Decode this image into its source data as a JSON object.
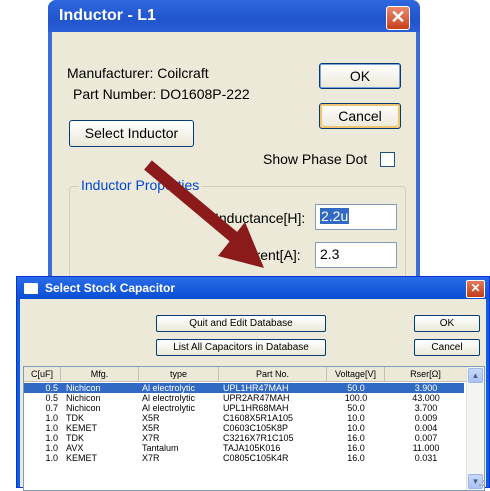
{
  "inductor_dialog": {
    "title": "Inductor - L1",
    "close_glyph": "✕",
    "manufacturer_label": "Manufacturer: Coilcraft",
    "part_number_label": "Part Number: DO1608P-222",
    "ok_label": "OK",
    "cancel_label": "Cancel",
    "select_inductor_label": "Select Inductor",
    "show_phase_dot_label": "Show Phase Dot",
    "show_phase_dot_checked": false,
    "group_title": "Inductor Properties",
    "inductance_label": "Inductance[H]:",
    "inductance_value": "2.2u",
    "peak_current_label": "Current[A]:",
    "peak_current_value": "2.3"
  },
  "capacitor_dialog": {
    "title": "Select Stock Capacitor",
    "close_glyph": "✕",
    "quit_edit_label": "Quit and Edit Database",
    "ok_label": "OK",
    "list_all_label": "List All Capacitors in Database",
    "cancel_label": "Cancel",
    "columns": [
      "C[uF]",
      "Mfg.",
      "type",
      "Part No.",
      "Voltage[V]",
      "Rser[Ω]"
    ],
    "rows": [
      {
        "c": "0.5",
        "mfg": "Nichicon",
        "type": "Al electrolytic",
        "part": "UPL1HR47MAH",
        "voltage": "50.0",
        "rser": "3.900",
        "selected": true
      },
      {
        "c": "0.5",
        "mfg": "Nichicon",
        "type": "Al electrolytic",
        "part": "UPR2AR47MAH",
        "voltage": "100.0",
        "rser": "43.000",
        "selected": false
      },
      {
        "c": "0.7",
        "mfg": "Nichicon",
        "type": "Al electrolytic",
        "part": "UPL1HR68MAH",
        "voltage": "50.0",
        "rser": "3.700",
        "selected": false
      },
      {
        "c": "1.0",
        "mfg": "TDK",
        "type": "X5R",
        "part": "C1608X5R1A105",
        "voltage": "10.0",
        "rser": "0.009",
        "selected": false
      },
      {
        "c": "1.0",
        "mfg": "KEMET",
        "type": "X5R",
        "part": "C0603C105K8P",
        "voltage": "10.0",
        "rser": "0.004",
        "selected": false
      },
      {
        "c": "1.0",
        "mfg": "TDK",
        "type": "X7R",
        "part": "C3216X7R1C105",
        "voltage": "16.0",
        "rser": "0.007",
        "selected": false
      },
      {
        "c": "1.0",
        "mfg": "AVX",
        "type": "Tantalum",
        "part": "TAJA105K016",
        "voltage": "16.0",
        "rser": "11.000",
        "selected": false
      },
      {
        "c": "1.0",
        "mfg": "KEMET",
        "type": "X7R",
        "part": "C0805C105K4R",
        "voltage": "16.0",
        "rser": "0.031",
        "selected": false
      }
    ]
  },
  "colors": {
    "xp_title_blue": "#2155cc",
    "dialog_face": "#ece9d8",
    "selection": "#316ac5",
    "arrow": "#8b1a1a",
    "group_title": "#0046d5"
  }
}
